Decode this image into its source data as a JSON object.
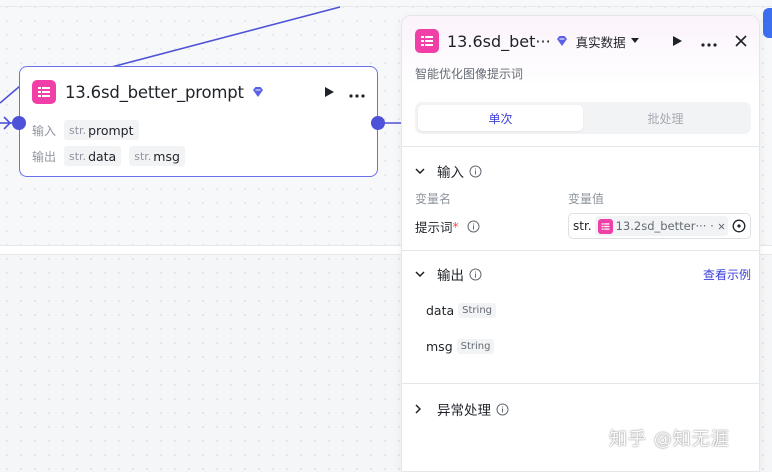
{
  "node": {
    "title": "13.6sd_better_prompt",
    "input_label": "输入",
    "output_label": "输出",
    "inputs": [
      {
        "type": "str.",
        "name": "prompt"
      }
    ],
    "outputs": [
      {
        "type": "str.",
        "name": "data"
      },
      {
        "type": "str.",
        "name": "msg"
      }
    ]
  },
  "panel": {
    "title": "13.6sd_bet···",
    "source_label": "真实数据",
    "description": "智能优化图像提示词",
    "tabs": [
      "单次",
      "批处理"
    ],
    "input_section": {
      "title": "输入",
      "col_name": "变量名",
      "col_value": "变量值",
      "variable": {
        "name": "提示词",
        "required_mark": "*",
        "type_prefix": "str.",
        "ref_text": "13.2sd_better··· ·"
      }
    },
    "output_section": {
      "title": "输出",
      "view_example": "查看示例",
      "items": [
        {
          "name": "data",
          "type": "String"
        },
        {
          "name": "msg",
          "type": "String"
        }
      ]
    },
    "error_section": {
      "title": "异常处理"
    }
  },
  "watermark": "知乎 @知无涯",
  "colors": {
    "accent": "#4e52d8",
    "plugin_icon": "#f040a8",
    "link": "#3c3fd9"
  }
}
